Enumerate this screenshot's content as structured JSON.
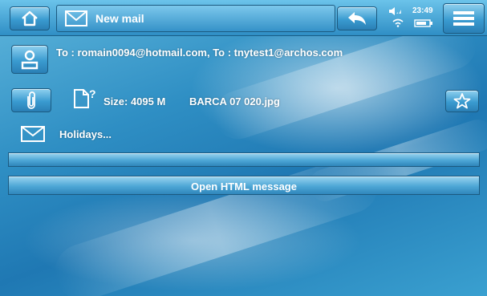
{
  "header": {
    "title": "New mail",
    "time": "23:49"
  },
  "mail": {
    "recipients": "To : romain0094@hotmail.com, To : tnytest1@archos.com",
    "attachment_size": "Size: 4095 M",
    "attachment_name": "BARCA 07 020.jpg",
    "subject": "Holidays..."
  },
  "actions": {
    "open_html": "Open HTML message"
  },
  "icons": [
    "home-icon",
    "envelope-icon",
    "back-arrow-icon",
    "volume-icon",
    "wifi-icon",
    "battery-icon",
    "menu-icon",
    "contact-icon",
    "paperclip-icon",
    "unknown-file-icon",
    "star-icon"
  ]
}
